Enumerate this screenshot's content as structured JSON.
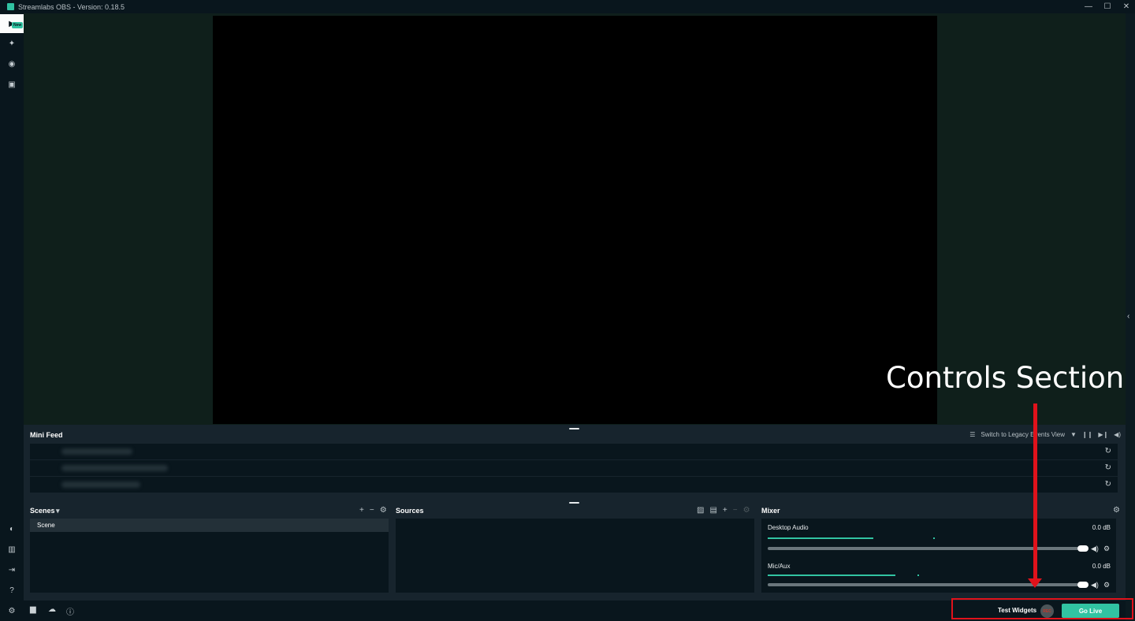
{
  "window": {
    "title": "Streamlabs OBS - Version: 0.18.5",
    "minimize": "—",
    "maximize": "☐",
    "close": "✕"
  },
  "sidebar": {
    "top": [
      {
        "name": "editor-icon",
        "glyph": "▶"
      },
      {
        "name": "themes-icon",
        "glyph": "✦"
      },
      {
        "name": "dashboard-icon",
        "glyph": "◉"
      },
      {
        "name": "store-icon",
        "glyph": "▣"
      }
    ],
    "badge": "New",
    "bottom": [
      {
        "name": "dashboard-icon",
        "glyph": "◐"
      },
      {
        "name": "studio-mode-icon",
        "glyph": "▥"
      },
      {
        "name": "logout-icon",
        "glyph": "⇥"
      },
      {
        "name": "help-icon",
        "glyph": "?"
      },
      {
        "name": "settings-icon",
        "glyph": "⚙"
      }
    ]
  },
  "minifeed": {
    "title": "Mini Feed",
    "switch_label": "Switch to Legacy Events View",
    "rows": [
      {
        "refresh": "↻"
      },
      {
        "refresh": "↻"
      },
      {
        "refresh": "↻"
      }
    ]
  },
  "scenes": {
    "title": "Scenes",
    "dropdown": "▾",
    "add": "+",
    "remove": "−",
    "settings": "⚙",
    "items": [
      "Scene"
    ]
  },
  "sources": {
    "title": "Sources",
    "add": "+",
    "remove": "−",
    "settings": "⚙"
  },
  "mixer": {
    "title": "Mixer",
    "channels": [
      {
        "name": "Desktop Audio",
        "db": "0.0 dB",
        "level": 0.34
      },
      {
        "name": "Mic/Aux",
        "db": "0.0 dB",
        "level": 0.41
      }
    ]
  },
  "footer": {
    "test_widgets": "Test Widgets",
    "rec": "REC",
    "go_live": "Go Live"
  },
  "annotation": {
    "label": "Controls Section",
    "color": "#e0121b"
  },
  "colors": {
    "accent": "#31c3a2",
    "bg_dark": "#09161d",
    "bg_panel": "#17242d"
  }
}
